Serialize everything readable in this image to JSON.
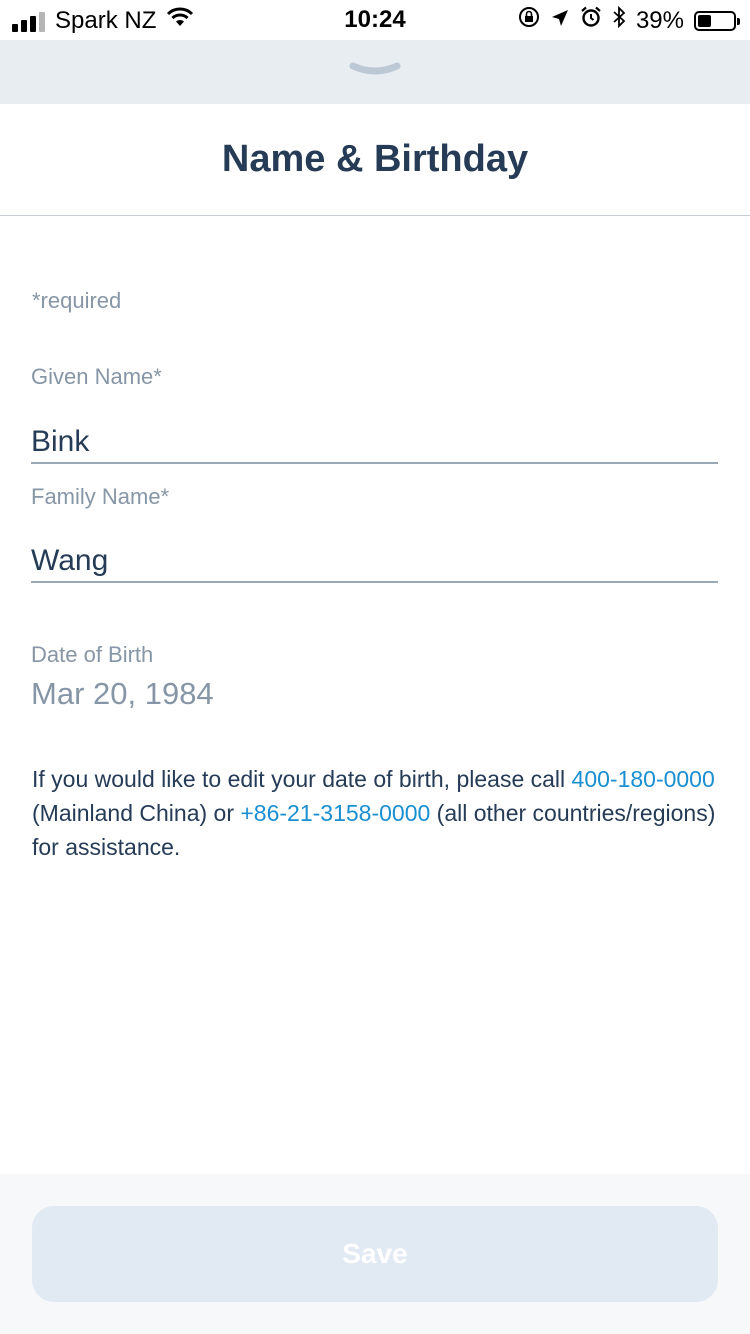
{
  "status_bar": {
    "carrier": "Spark NZ",
    "time": "10:24",
    "battery_percent": "39%",
    "battery_level": 0.39,
    "icons": [
      "signal-icon",
      "wifi-icon",
      "orientation-lock-icon",
      "location-icon",
      "alarm-icon",
      "bluetooth-icon",
      "battery-icon"
    ]
  },
  "header": {
    "title": "Name & Birthday",
    "handle_icon": "chevron-down-icon"
  },
  "form": {
    "required_note": "*required",
    "given_name": {
      "label": "Given Name*",
      "value": "Bink"
    },
    "family_name": {
      "label": "Family Name*",
      "value": "Wang"
    },
    "date_of_birth": {
      "label": "Date of Birth",
      "value": "Mar 20, 1984"
    }
  },
  "help": {
    "text_1": "If you would like to edit your date of birth, please call ",
    "phone_1": "400-180-0000",
    "text_2": " (Mainland China) or ",
    "phone_2": "+86-21-3158-0000",
    "text_3": " (all other countries/regions) for assistance."
  },
  "footer": {
    "save_label": "Save"
  },
  "colors": {
    "title": "#253b56",
    "label": "#8796a6",
    "link": "#1a8fd1",
    "handle_bar": "#e8edf2",
    "save_disabled": "#e1e9f3"
  }
}
